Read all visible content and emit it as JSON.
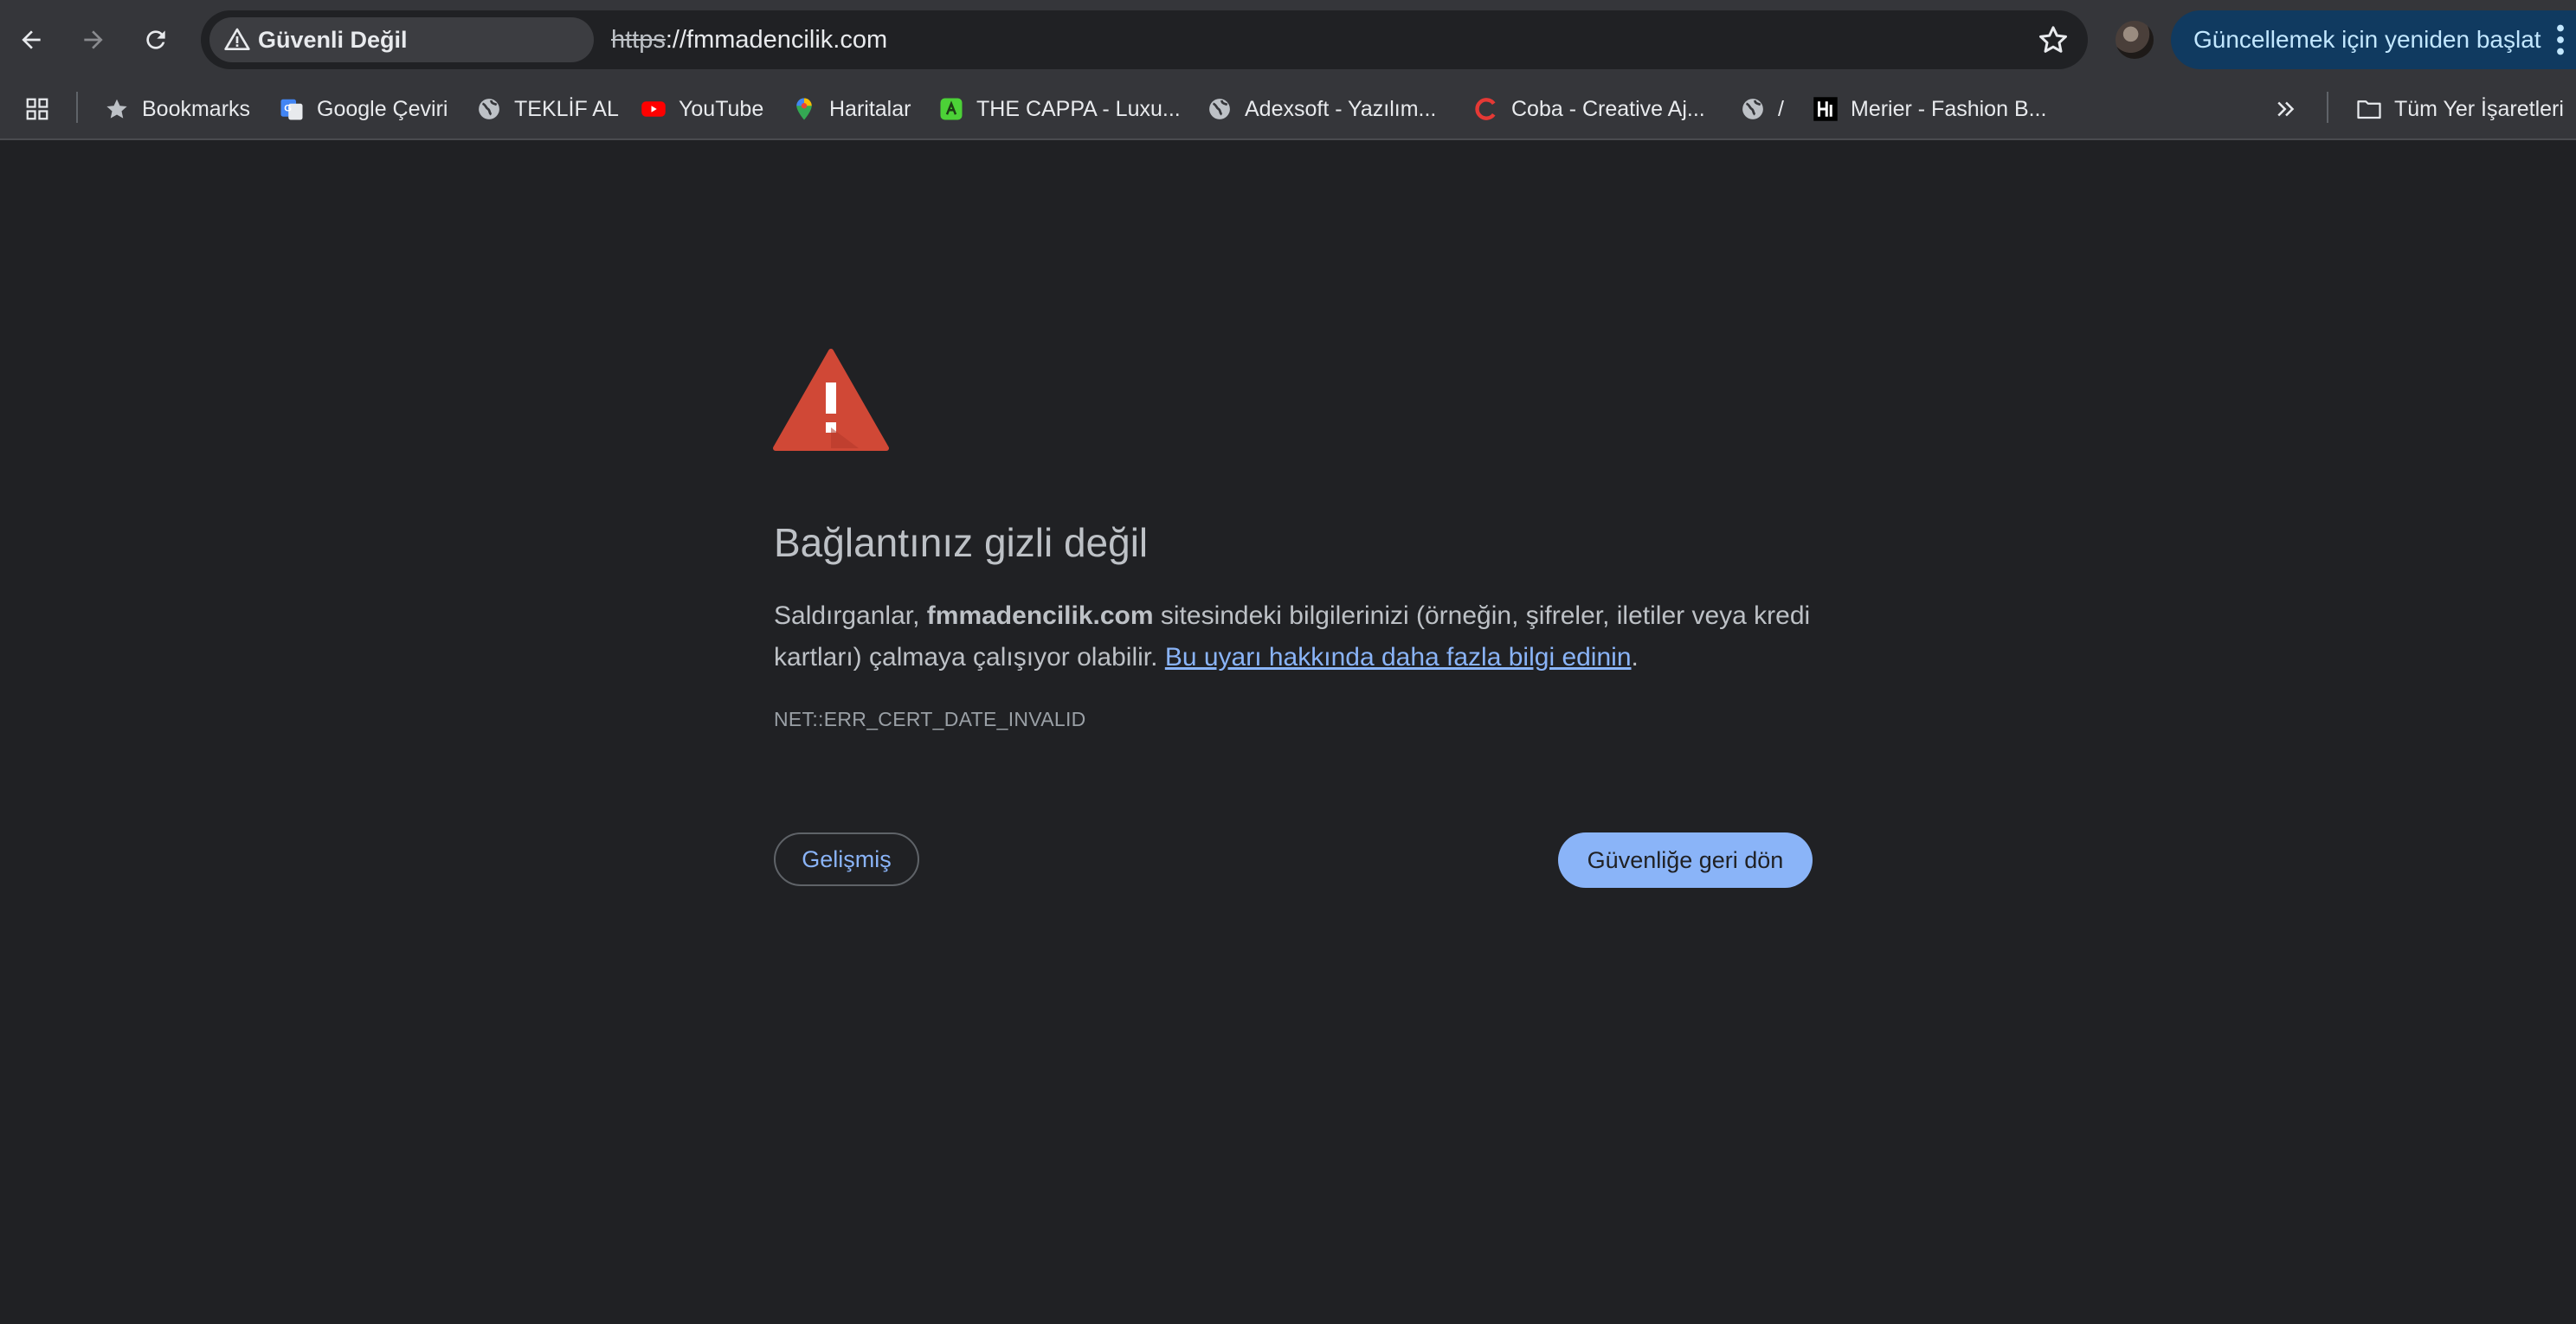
{
  "toolbar": {
    "security_chip": "Güvenli Değil",
    "url_scheme": "https",
    "url_rest": "://fmmadencilik.com",
    "update_button": "Güncellemek için yeniden başlat"
  },
  "bookmarks": {
    "items": [
      {
        "label": "Bookmarks",
        "icon": "star-icon"
      },
      {
        "label": "Google Çeviri",
        "icon": "google-translate-icon"
      },
      {
        "label": "TEKLİF AL",
        "icon": "globe-icon"
      },
      {
        "label": "YouTube",
        "icon": "youtube-icon"
      },
      {
        "label": "Haritalar",
        "icon": "maps-icon"
      },
      {
        "label": "THE CAPPA - Luxu...",
        "icon": "cappa-icon"
      },
      {
        "label": "Adexsoft - Yazılım...",
        "icon": "globe-icon"
      },
      {
        "label": "Coba - Creative Aj...",
        "icon": "coba-icon"
      },
      {
        "label": "/",
        "icon": "globe-icon"
      },
      {
        "label": "Merier - Fashion B...",
        "icon": "merier-icon"
      }
    ],
    "all_bookmarks": "Tüm Yer İşaretleri"
  },
  "page": {
    "heading": "Bağlantınız gizli değil",
    "para_prefix": "Saldırganlar, ",
    "para_domain": "fmmadencilik.com",
    "para_middle": " sitesindeki bilgilerinizi (örneğin, şifreler, iletiler veya kredi kartları) çalmaya çalışıyor olabilir. ",
    "para_link": "Bu uyarı hakkında daha fazla bilgi edinin",
    "para_suffix": ".",
    "error_code": "NET::ERR_CERT_DATE_INVALID",
    "advanced_button": "Gelişmiş",
    "back_button": "Güvenliğe geri dön"
  },
  "colors": {
    "background": "#202124",
    "toolbar": "#35363a",
    "warning_red": "#d04836",
    "link_blue": "#8ab4f8",
    "update_button_bg": "#103a60"
  }
}
